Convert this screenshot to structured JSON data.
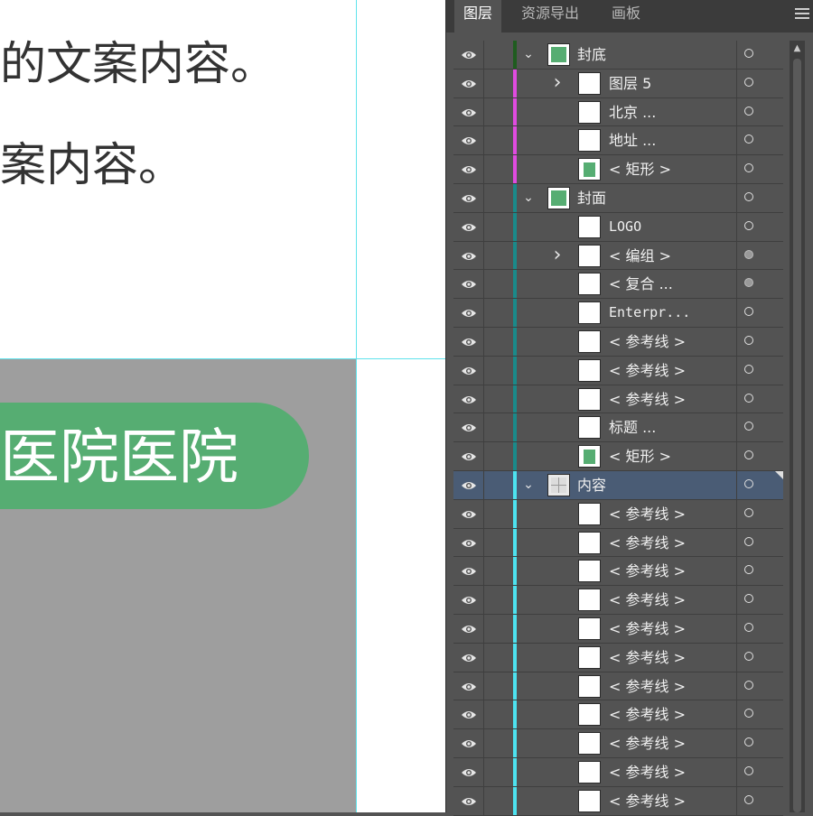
{
  "canvas": {
    "text_line_1": "的文案内容。",
    "text_line_2": "案内容。",
    "pill_text": "医院医院"
  },
  "panel": {
    "tabs": [
      {
        "label": "图层",
        "active": true
      },
      {
        "label": "资源导出",
        "active": false
      },
      {
        "label": "画板",
        "active": false
      }
    ],
    "layers": [
      {
        "label": "封底",
        "chevron": "down",
        "thumb": "group-green",
        "color": "#1f5c1f",
        "target": "empty"
      },
      {
        "label": "图层 5",
        "chevron": "right",
        "thumb": "white",
        "color": "#e04be0",
        "target": "empty"
      },
      {
        "label": "北京 ...",
        "chevron": "",
        "thumb": "white",
        "color": "#e04be0",
        "target": "empty"
      },
      {
        "label": "地址 ...",
        "chevron": "",
        "thumb": "white",
        "color": "#e04be0",
        "target": "empty"
      },
      {
        "label": "< 矩形 >",
        "chevron": "",
        "thumb": "green",
        "color": "#e04be0",
        "target": "empty"
      },
      {
        "label": "封面",
        "chevron": "down",
        "thumb": "group-green",
        "color": "#1a8a8a",
        "target": "empty"
      },
      {
        "label": "LOGO",
        "chevron": "",
        "thumb": "white",
        "color": "#1a8a8a",
        "target": "empty"
      },
      {
        "label": "< 编组 >",
        "chevron": "right",
        "thumb": "white",
        "color": "#1a8a8a",
        "target": "filled"
      },
      {
        "label": "< 复合 ...",
        "chevron": "",
        "thumb": "white",
        "color": "#1a8a8a",
        "target": "filled"
      },
      {
        "label": "Enterpr...",
        "chevron": "",
        "thumb": "white",
        "color": "#1a8a8a",
        "target": "empty"
      },
      {
        "label": "< 参考线 >",
        "chevron": "",
        "thumb": "white",
        "color": "#1a8a8a",
        "target": "empty"
      },
      {
        "label": "< 参考线 >",
        "chevron": "",
        "thumb": "white",
        "color": "#1a8a8a",
        "target": "empty"
      },
      {
        "label": "< 参考线 >",
        "chevron": "",
        "thumb": "white",
        "color": "#1a8a8a",
        "target": "empty"
      },
      {
        "label": "标题 ...",
        "chevron": "",
        "thumb": "white",
        "color": "#1a8a8a",
        "target": "empty"
      },
      {
        "label": "< 矩形 >",
        "chevron": "",
        "thumb": "green",
        "color": "#1a8a8a",
        "target": "empty"
      },
      {
        "label": "内容",
        "chevron": "down",
        "thumb": "grid",
        "color": "#4de3f0",
        "target": "empty",
        "selected": true
      },
      {
        "label": "< 参考线 >",
        "chevron": "",
        "thumb": "white",
        "color": "#4de3f0",
        "target": "empty"
      },
      {
        "label": "< 参考线 >",
        "chevron": "",
        "thumb": "white",
        "color": "#4de3f0",
        "target": "empty"
      },
      {
        "label": "< 参考线 >",
        "chevron": "",
        "thumb": "white",
        "color": "#4de3f0",
        "target": "empty"
      },
      {
        "label": "< 参考线 >",
        "chevron": "",
        "thumb": "white",
        "color": "#4de3f0",
        "target": "empty"
      },
      {
        "label": "< 参考线 >",
        "chevron": "",
        "thumb": "white",
        "color": "#4de3f0",
        "target": "empty"
      },
      {
        "label": "< 参考线 >",
        "chevron": "",
        "thumb": "white",
        "color": "#4de3f0",
        "target": "empty"
      },
      {
        "label": "< 参考线 >",
        "chevron": "",
        "thumb": "white",
        "color": "#4de3f0",
        "target": "empty"
      },
      {
        "label": "< 参考线 >",
        "chevron": "",
        "thumb": "white",
        "color": "#4de3f0",
        "target": "empty"
      },
      {
        "label": "< 参考线 >",
        "chevron": "",
        "thumb": "white",
        "color": "#4de3f0",
        "target": "empty"
      },
      {
        "label": "< 参考线 >",
        "chevron": "",
        "thumb": "white",
        "color": "#4de3f0",
        "target": "empty"
      },
      {
        "label": "< 参考线 >",
        "chevron": "",
        "thumb": "white",
        "color": "#4de3f0",
        "target": "empty"
      }
    ]
  }
}
